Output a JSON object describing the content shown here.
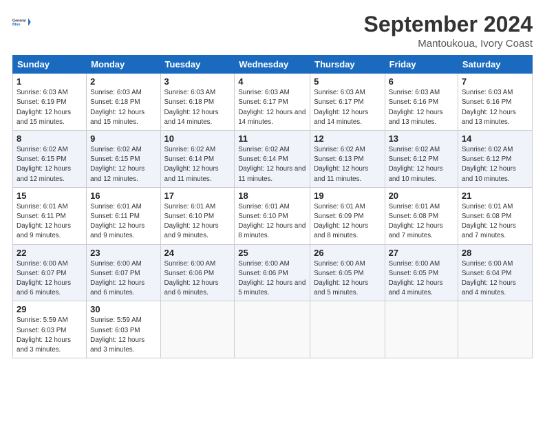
{
  "header": {
    "month_title": "September 2024",
    "location": "Mantoukoua, Ivory Coast"
  },
  "columns": [
    "Sunday",
    "Monday",
    "Tuesday",
    "Wednesday",
    "Thursday",
    "Friday",
    "Saturday"
  ],
  "weeks": [
    [
      {
        "day": "1",
        "sunrise": "Sunrise: 6:03 AM",
        "sunset": "Sunset: 6:19 PM",
        "daylight": "Daylight: 12 hours and 15 minutes."
      },
      {
        "day": "2",
        "sunrise": "Sunrise: 6:03 AM",
        "sunset": "Sunset: 6:18 PM",
        "daylight": "Daylight: 12 hours and 15 minutes."
      },
      {
        "day": "3",
        "sunrise": "Sunrise: 6:03 AM",
        "sunset": "Sunset: 6:18 PM",
        "daylight": "Daylight: 12 hours and 14 minutes."
      },
      {
        "day": "4",
        "sunrise": "Sunrise: 6:03 AM",
        "sunset": "Sunset: 6:17 PM",
        "daylight": "Daylight: 12 hours and 14 minutes."
      },
      {
        "day": "5",
        "sunrise": "Sunrise: 6:03 AM",
        "sunset": "Sunset: 6:17 PM",
        "daylight": "Daylight: 12 hours and 14 minutes."
      },
      {
        "day": "6",
        "sunrise": "Sunrise: 6:03 AM",
        "sunset": "Sunset: 6:16 PM",
        "daylight": "Daylight: 12 hours and 13 minutes."
      },
      {
        "day": "7",
        "sunrise": "Sunrise: 6:03 AM",
        "sunset": "Sunset: 6:16 PM",
        "daylight": "Daylight: 12 hours and 13 minutes."
      }
    ],
    [
      {
        "day": "8",
        "sunrise": "Sunrise: 6:02 AM",
        "sunset": "Sunset: 6:15 PM",
        "daylight": "Daylight: 12 hours and 12 minutes."
      },
      {
        "day": "9",
        "sunrise": "Sunrise: 6:02 AM",
        "sunset": "Sunset: 6:15 PM",
        "daylight": "Daylight: 12 hours and 12 minutes."
      },
      {
        "day": "10",
        "sunrise": "Sunrise: 6:02 AM",
        "sunset": "Sunset: 6:14 PM",
        "daylight": "Daylight: 12 hours and 11 minutes."
      },
      {
        "day": "11",
        "sunrise": "Sunrise: 6:02 AM",
        "sunset": "Sunset: 6:14 PM",
        "daylight": "Daylight: 12 hours and 11 minutes."
      },
      {
        "day": "12",
        "sunrise": "Sunrise: 6:02 AM",
        "sunset": "Sunset: 6:13 PM",
        "daylight": "Daylight: 12 hours and 11 minutes."
      },
      {
        "day": "13",
        "sunrise": "Sunrise: 6:02 AM",
        "sunset": "Sunset: 6:12 PM",
        "daylight": "Daylight: 12 hours and 10 minutes."
      },
      {
        "day": "14",
        "sunrise": "Sunrise: 6:02 AM",
        "sunset": "Sunset: 6:12 PM",
        "daylight": "Daylight: 12 hours and 10 minutes."
      }
    ],
    [
      {
        "day": "15",
        "sunrise": "Sunrise: 6:01 AM",
        "sunset": "Sunset: 6:11 PM",
        "daylight": "Daylight: 12 hours and 9 minutes."
      },
      {
        "day": "16",
        "sunrise": "Sunrise: 6:01 AM",
        "sunset": "Sunset: 6:11 PM",
        "daylight": "Daylight: 12 hours and 9 minutes."
      },
      {
        "day": "17",
        "sunrise": "Sunrise: 6:01 AM",
        "sunset": "Sunset: 6:10 PM",
        "daylight": "Daylight: 12 hours and 9 minutes."
      },
      {
        "day": "18",
        "sunrise": "Sunrise: 6:01 AM",
        "sunset": "Sunset: 6:10 PM",
        "daylight": "Daylight: 12 hours and 8 minutes."
      },
      {
        "day": "19",
        "sunrise": "Sunrise: 6:01 AM",
        "sunset": "Sunset: 6:09 PM",
        "daylight": "Daylight: 12 hours and 8 minutes."
      },
      {
        "day": "20",
        "sunrise": "Sunrise: 6:01 AM",
        "sunset": "Sunset: 6:08 PM",
        "daylight": "Daylight: 12 hours and 7 minutes."
      },
      {
        "day": "21",
        "sunrise": "Sunrise: 6:01 AM",
        "sunset": "Sunset: 6:08 PM",
        "daylight": "Daylight: 12 hours and 7 minutes."
      }
    ],
    [
      {
        "day": "22",
        "sunrise": "Sunrise: 6:00 AM",
        "sunset": "Sunset: 6:07 PM",
        "daylight": "Daylight: 12 hours and 6 minutes."
      },
      {
        "day": "23",
        "sunrise": "Sunrise: 6:00 AM",
        "sunset": "Sunset: 6:07 PM",
        "daylight": "Daylight: 12 hours and 6 minutes."
      },
      {
        "day": "24",
        "sunrise": "Sunrise: 6:00 AM",
        "sunset": "Sunset: 6:06 PM",
        "daylight": "Daylight: 12 hours and 6 minutes."
      },
      {
        "day": "25",
        "sunrise": "Sunrise: 6:00 AM",
        "sunset": "Sunset: 6:06 PM",
        "daylight": "Daylight: 12 hours and 5 minutes."
      },
      {
        "day": "26",
        "sunrise": "Sunrise: 6:00 AM",
        "sunset": "Sunset: 6:05 PM",
        "daylight": "Daylight: 12 hours and 5 minutes."
      },
      {
        "day": "27",
        "sunrise": "Sunrise: 6:00 AM",
        "sunset": "Sunset: 6:05 PM",
        "daylight": "Daylight: 12 hours and 4 minutes."
      },
      {
        "day": "28",
        "sunrise": "Sunrise: 6:00 AM",
        "sunset": "Sunset: 6:04 PM",
        "daylight": "Daylight: 12 hours and 4 minutes."
      }
    ],
    [
      {
        "day": "29",
        "sunrise": "Sunrise: 5:59 AM",
        "sunset": "Sunset: 6:03 PM",
        "daylight": "Daylight: 12 hours and 3 minutes."
      },
      {
        "day": "30",
        "sunrise": "Sunrise: 5:59 AM",
        "sunset": "Sunset: 6:03 PM",
        "daylight": "Daylight: 12 hours and 3 minutes."
      },
      null,
      null,
      null,
      null,
      null
    ]
  ]
}
